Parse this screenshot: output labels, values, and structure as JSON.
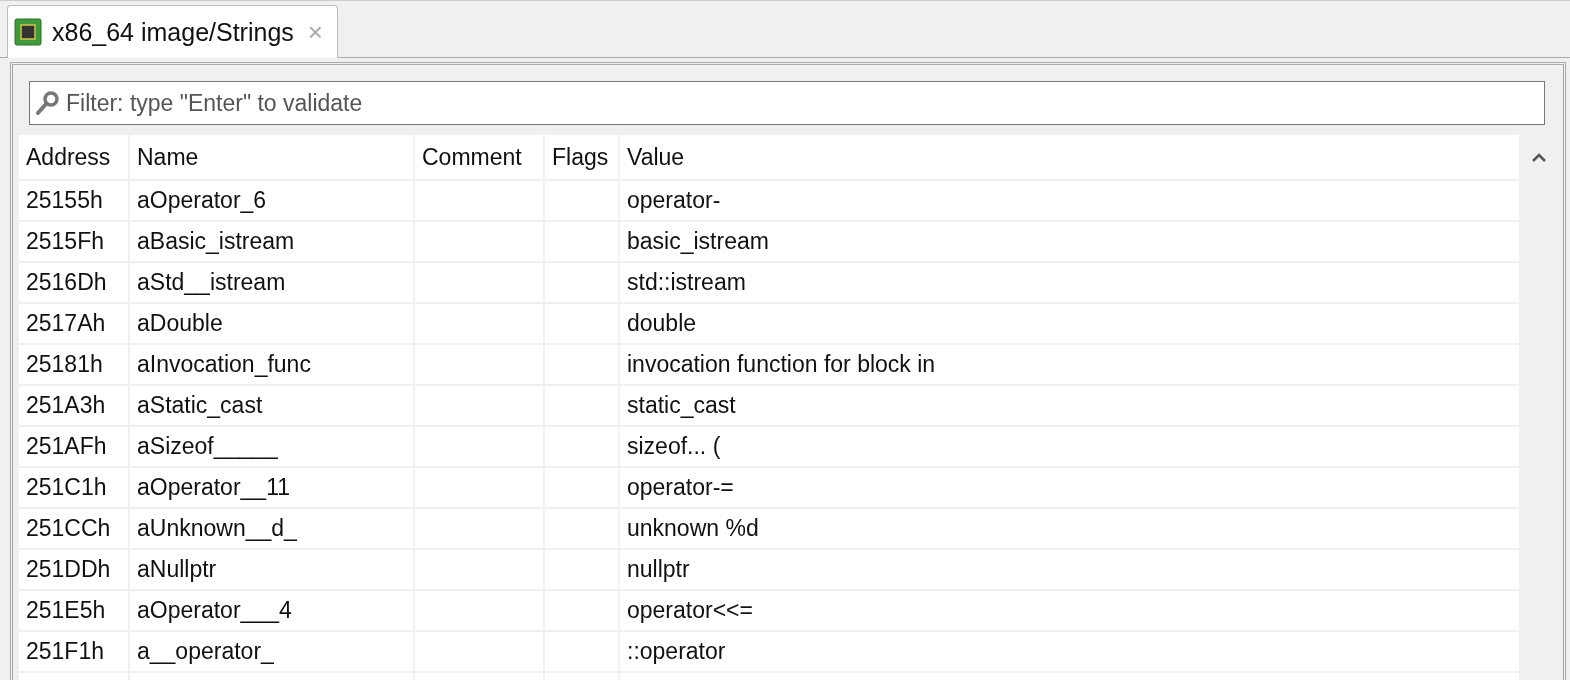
{
  "tabs": [
    {
      "label": "x86_64 image/Strings",
      "selected": true,
      "close": "×"
    }
  ],
  "filter": {
    "placeholder": "Filter: type \"Enter\" to validate"
  },
  "table": {
    "columns": [
      "Address",
      "Name",
      "Comment",
      "Flags",
      "Value"
    ],
    "rows": [
      [
        "25155h",
        "aOperator_6",
        "",
        "",
        "operator-"
      ],
      [
        "2515Fh",
        "aBasic_istream",
        "",
        "",
        "basic_istream"
      ],
      [
        "2516Dh",
        "aStd__istream",
        "",
        "",
        "std::istream"
      ],
      [
        "2517Ah",
        "aDouble",
        "",
        "",
        "double"
      ],
      [
        "25181h",
        "aInvocation_func",
        "",
        "",
        "invocation function for block in"
      ],
      [
        "251A3h",
        "aStatic_cast",
        "",
        "",
        "static_cast"
      ],
      [
        "251AFh",
        "aSizeof_____",
        "",
        "",
        "sizeof... ("
      ],
      [
        "251C1h",
        "aOperator__11",
        "",
        "",
        "operator-="
      ],
      [
        "251CCh",
        "aUnknown__d_",
        "",
        "",
        "unknown %d"
      ],
      [
        "251DDh",
        "aNullptr",
        "",
        "",
        "nullptr"
      ],
      [
        "251E5h",
        "aOperator___4",
        "",
        "",
        "operator<<="
      ],
      [
        "251F1h",
        "a__operator_",
        "",
        "",
        "::operator"
      ]
    ]
  }
}
